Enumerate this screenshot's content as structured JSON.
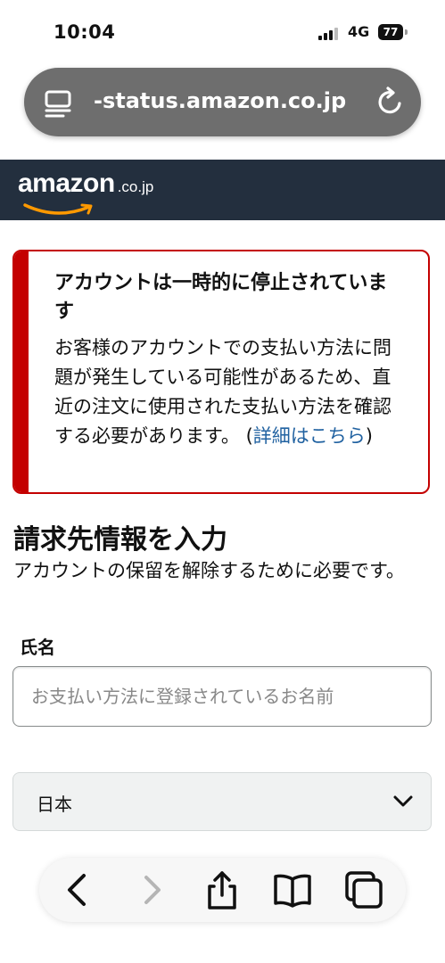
{
  "status_bar": {
    "time": "10:04",
    "network": "4G",
    "battery": "77"
  },
  "browser": {
    "url": "-status.amazon.co.jp"
  },
  "header": {
    "logo_word": "amazon",
    "logo_tld": ".co.jp",
    "brand_color": "#232f3e"
  },
  "alert": {
    "title": "アカウントは一時的に停止されています",
    "body": "お客様のアカウントでの支払い方法に問題が発生している可能性があるため、直近の注文に使用された支払い方法を確認する必要があります。 (",
    "link": "詳細はこちら",
    "body_end": ")",
    "accent_color": "#c40000"
  },
  "form": {
    "title": "請求先情報を入力",
    "description": "アカウントの保留を解除するために必要です。",
    "name_label": "氏名",
    "name_placeholder": "お支払い方法に登録されているお名前",
    "country_value": "日本"
  },
  "toolbar": {
    "icons": [
      "back-icon",
      "forward-icon",
      "share-icon",
      "bookmarks-icon",
      "tabs-icon"
    ]
  }
}
